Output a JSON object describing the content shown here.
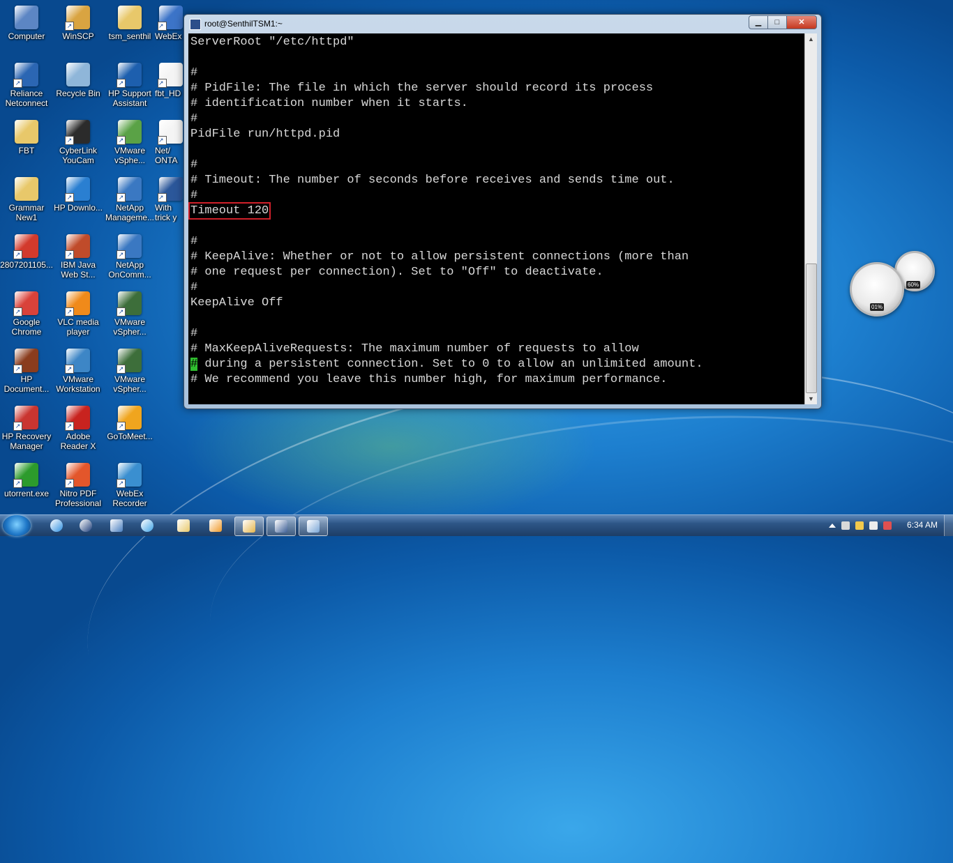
{
  "desktop_icons": [
    {
      "label": "Computer",
      "color": "#5c86c4"
    },
    {
      "label": "WinSCP",
      "color": "#d9a441"
    },
    {
      "label": "tsm_senthil",
      "color": "#e8c86a"
    },
    {
      "label": "WebEx",
      "color": "#3c74c8"
    },
    {
      "label": "Reliance Netconnect",
      "color": "#2b66b3"
    },
    {
      "label": "Recycle Bin",
      "color": "#8fb6d9"
    },
    {
      "label": "HP Support Assistant",
      "color": "#1d5fae"
    },
    {
      "label": "fbt_HD",
      "color": "#f4f4f4"
    },
    {
      "label": "FBT",
      "color": "#e8c86a"
    },
    {
      "label": "CyberLink YouCam",
      "color": "#2b2b2b"
    },
    {
      "label": "VMware vSphe...",
      "color": "#5aa246"
    },
    {
      "label": "Net/ ONTA",
      "color": "#f4f4f4"
    },
    {
      "label": "Grammar New1",
      "color": "#e8c86a"
    },
    {
      "label": "HP Downlo...",
      "color": "#2a7fd1"
    },
    {
      "label": "NetApp Manageme...",
      "color": "#3a78c2"
    },
    {
      "label": "With trick y",
      "color": "#2b579a"
    },
    {
      "label": "2807201105...",
      "color": "#d23a2c"
    },
    {
      "label": "IBM Java Web St...",
      "color": "#c04b2a"
    },
    {
      "label": "NetApp OnComm...",
      "color": "#3a78c2"
    },
    {
      "label": "Google Chrome",
      "color": "#d9423a"
    },
    {
      "label": "VLC media player",
      "color": "#f08a1a"
    },
    {
      "label": "VMware vSpher...",
      "color": "#3d6e3a"
    },
    {
      "label": "HP Document...",
      "color": "#8a3c1d"
    },
    {
      "label": "VMware Workstation",
      "color": "#3d86c6"
    },
    {
      "label": "VMware vSpher...",
      "color": "#3d6e3a"
    },
    {
      "label": "HP Recovery Manager",
      "color": "#c93530"
    },
    {
      "label": "Adobe Reader X",
      "color": "#c8231f"
    },
    {
      "label": "GoToMeet...",
      "color": "#f0a51e"
    },
    {
      "label": "utorrent.exe",
      "color": "#2c9b2c"
    },
    {
      "label": "Nitro PDF Professional",
      "color": "#e3562b"
    },
    {
      "label": "WebEx Recorder",
      "color": "#3a8fd0"
    }
  ],
  "window": {
    "title": "root@SenthilTSM1:~",
    "minimize_label": "▁",
    "maximize_label": "□",
    "close_label": "✕"
  },
  "terminal": {
    "lines": [
      "ServerRoot \"/etc/httpd\"",
      "",
      "#",
      "# PidFile: The file in which the server should record its process",
      "# identification number when it starts.",
      "#",
      "PidFile run/httpd.pid",
      "",
      "#",
      "# Timeout: The number of seconds before receives and sends time out.",
      "#",
      "Timeout 120",
      "",
      "#",
      "# KeepAlive: Whether or not to allow persistent connections (more than",
      "# one request per connection). Set to \"Off\" to deactivate.",
      "#",
      "KeepAlive Off",
      "",
      "#",
      "# MaxKeepAliveRequests: The maximum number of requests to allow",
      "# during a persistent connection. Set to 0 to allow an unlimited amount.",
      "# We recommend you leave this number high, for maximum performance."
    ],
    "highlight_color": "#d0202a",
    "cursor_color": "#2fbf2f"
  },
  "gadget": {
    "cpu_value": "01%",
    "memory_value": "60%"
  },
  "taskbar": {
    "pinned": [
      {
        "name": "internet-explorer-icon",
        "color": "#2e8fe0"
      },
      {
        "name": "hp-icon",
        "color": "#1f3f7a"
      },
      {
        "name": "mail-icon",
        "color": "#4a7fc0"
      },
      {
        "name": "media-center-icon",
        "color": "#3fa3e6"
      },
      {
        "name": "explorer-icon",
        "color": "#e8c86a"
      },
      {
        "name": "media-player-icon",
        "color": "#f09a2a"
      },
      {
        "name": "folder-icon",
        "color": "#e6b54a"
      },
      {
        "name": "putty-icon",
        "color": "#3d5f96"
      },
      {
        "name": "remote-desktop-icon",
        "color": "#7aa6d6"
      }
    ],
    "clock": "6:34 AM"
  }
}
